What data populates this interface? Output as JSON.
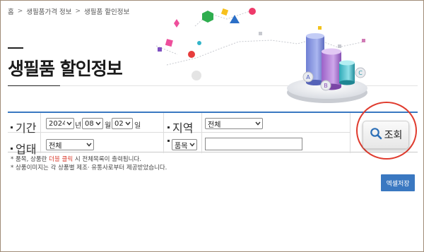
{
  "breadcrumb": {
    "home": "홈",
    "level1": "생필품가격 정보",
    "level2": "생필품 할인정보",
    "separator": ">"
  },
  "page": {
    "title": "생필품 할인정보"
  },
  "search": {
    "period_label": "기간",
    "year_value": "2024",
    "year_unit": "년",
    "month_value": "08",
    "month_unit": "월",
    "day_value": "02",
    "day_unit": "일",
    "region_label": "지역",
    "region_value": "전체",
    "business_label": "업태",
    "business_value": "전체",
    "item_select_value": "품목",
    "item_input_value": "",
    "search_button_label": "조회"
  },
  "notes": {
    "line1_before": "* 품목, 상품란 ",
    "line1_highlight": "더블 클릭",
    "line1_after": " 시 전체목록이 출력됩니다.",
    "line2": "* 상품이미지는 각 상품별 제조· 유통사로부터 제공받았습니다."
  },
  "actions": {
    "excel_save_label": "엑셀저장"
  },
  "colors": {
    "accent_blue": "#3a78c1",
    "highlight_red": "#d93a2b",
    "circle_red": "#e03b2e"
  },
  "icons": {
    "search_button_icon": "magnifier-icon",
    "select_arrow": "chevron-down-icon"
  }
}
